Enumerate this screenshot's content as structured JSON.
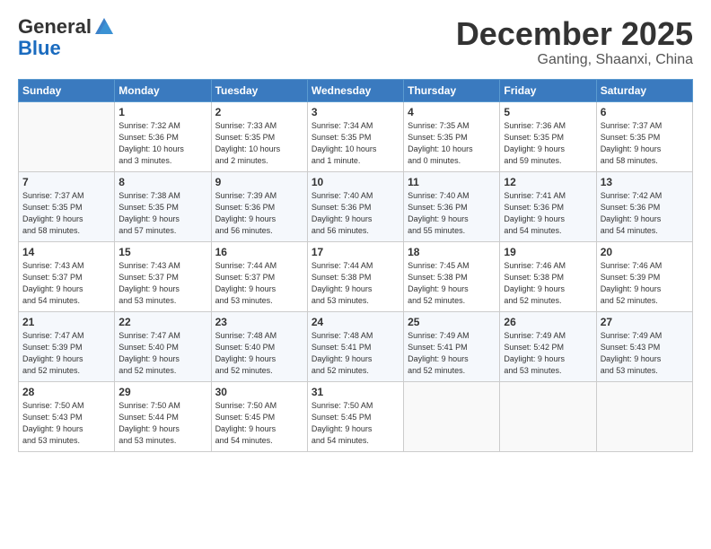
{
  "header": {
    "logo_general": "General",
    "logo_blue": "Blue",
    "month": "December 2025",
    "location": "Ganting, Shaanxi, China"
  },
  "days_of_week": [
    "Sunday",
    "Monday",
    "Tuesday",
    "Wednesday",
    "Thursday",
    "Friday",
    "Saturday"
  ],
  "weeks": [
    [
      {
        "day": "",
        "info": ""
      },
      {
        "day": "1",
        "info": "Sunrise: 7:32 AM\nSunset: 5:36 PM\nDaylight: 10 hours\nand 3 minutes."
      },
      {
        "day": "2",
        "info": "Sunrise: 7:33 AM\nSunset: 5:35 PM\nDaylight: 10 hours\nand 2 minutes."
      },
      {
        "day": "3",
        "info": "Sunrise: 7:34 AM\nSunset: 5:35 PM\nDaylight: 10 hours\nand 1 minute."
      },
      {
        "day": "4",
        "info": "Sunrise: 7:35 AM\nSunset: 5:35 PM\nDaylight: 10 hours\nand 0 minutes."
      },
      {
        "day": "5",
        "info": "Sunrise: 7:36 AM\nSunset: 5:35 PM\nDaylight: 9 hours\nand 59 minutes."
      },
      {
        "day": "6",
        "info": "Sunrise: 7:37 AM\nSunset: 5:35 PM\nDaylight: 9 hours\nand 58 minutes."
      }
    ],
    [
      {
        "day": "7",
        "info": "Sunrise: 7:37 AM\nSunset: 5:35 PM\nDaylight: 9 hours\nand 58 minutes."
      },
      {
        "day": "8",
        "info": "Sunrise: 7:38 AM\nSunset: 5:35 PM\nDaylight: 9 hours\nand 57 minutes."
      },
      {
        "day": "9",
        "info": "Sunrise: 7:39 AM\nSunset: 5:36 PM\nDaylight: 9 hours\nand 56 minutes."
      },
      {
        "day": "10",
        "info": "Sunrise: 7:40 AM\nSunset: 5:36 PM\nDaylight: 9 hours\nand 56 minutes."
      },
      {
        "day": "11",
        "info": "Sunrise: 7:40 AM\nSunset: 5:36 PM\nDaylight: 9 hours\nand 55 minutes."
      },
      {
        "day": "12",
        "info": "Sunrise: 7:41 AM\nSunset: 5:36 PM\nDaylight: 9 hours\nand 54 minutes."
      },
      {
        "day": "13",
        "info": "Sunrise: 7:42 AM\nSunset: 5:36 PM\nDaylight: 9 hours\nand 54 minutes."
      }
    ],
    [
      {
        "day": "14",
        "info": "Sunrise: 7:43 AM\nSunset: 5:37 PM\nDaylight: 9 hours\nand 54 minutes."
      },
      {
        "day": "15",
        "info": "Sunrise: 7:43 AM\nSunset: 5:37 PM\nDaylight: 9 hours\nand 53 minutes."
      },
      {
        "day": "16",
        "info": "Sunrise: 7:44 AM\nSunset: 5:37 PM\nDaylight: 9 hours\nand 53 minutes."
      },
      {
        "day": "17",
        "info": "Sunrise: 7:44 AM\nSunset: 5:38 PM\nDaylight: 9 hours\nand 53 minutes."
      },
      {
        "day": "18",
        "info": "Sunrise: 7:45 AM\nSunset: 5:38 PM\nDaylight: 9 hours\nand 52 minutes."
      },
      {
        "day": "19",
        "info": "Sunrise: 7:46 AM\nSunset: 5:38 PM\nDaylight: 9 hours\nand 52 minutes."
      },
      {
        "day": "20",
        "info": "Sunrise: 7:46 AM\nSunset: 5:39 PM\nDaylight: 9 hours\nand 52 minutes."
      }
    ],
    [
      {
        "day": "21",
        "info": "Sunrise: 7:47 AM\nSunset: 5:39 PM\nDaylight: 9 hours\nand 52 minutes."
      },
      {
        "day": "22",
        "info": "Sunrise: 7:47 AM\nSunset: 5:40 PM\nDaylight: 9 hours\nand 52 minutes."
      },
      {
        "day": "23",
        "info": "Sunrise: 7:48 AM\nSunset: 5:40 PM\nDaylight: 9 hours\nand 52 minutes."
      },
      {
        "day": "24",
        "info": "Sunrise: 7:48 AM\nSunset: 5:41 PM\nDaylight: 9 hours\nand 52 minutes."
      },
      {
        "day": "25",
        "info": "Sunrise: 7:49 AM\nSunset: 5:41 PM\nDaylight: 9 hours\nand 52 minutes."
      },
      {
        "day": "26",
        "info": "Sunrise: 7:49 AM\nSunset: 5:42 PM\nDaylight: 9 hours\nand 53 minutes."
      },
      {
        "day": "27",
        "info": "Sunrise: 7:49 AM\nSunset: 5:43 PM\nDaylight: 9 hours\nand 53 minutes."
      }
    ],
    [
      {
        "day": "28",
        "info": "Sunrise: 7:50 AM\nSunset: 5:43 PM\nDaylight: 9 hours\nand 53 minutes."
      },
      {
        "day": "29",
        "info": "Sunrise: 7:50 AM\nSunset: 5:44 PM\nDaylight: 9 hours\nand 53 minutes."
      },
      {
        "day": "30",
        "info": "Sunrise: 7:50 AM\nSunset: 5:45 PM\nDaylight: 9 hours\nand 54 minutes."
      },
      {
        "day": "31",
        "info": "Sunrise: 7:50 AM\nSunset: 5:45 PM\nDaylight: 9 hours\nand 54 minutes."
      },
      {
        "day": "",
        "info": ""
      },
      {
        "day": "",
        "info": ""
      },
      {
        "day": "",
        "info": ""
      }
    ]
  ]
}
